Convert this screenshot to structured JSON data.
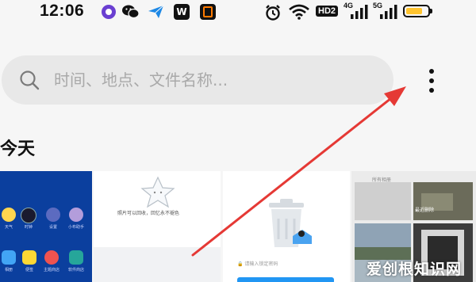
{
  "status_bar": {
    "time": "12:06",
    "hd_label": "HD2",
    "net_1": "4G",
    "net_2": "5G",
    "battery_level": 0.75,
    "icons": [
      "app-icon",
      "wechat-icon",
      "send-icon",
      "wps-icon",
      "app-icon",
      "alarm-icon",
      "wifi-icon",
      "signal-icon",
      "signal-icon",
      "battery-icon"
    ]
  },
  "search": {
    "placeholder": "时间、地点、文件名称..."
  },
  "menu": {
    "icon": "more-vertical-icon"
  },
  "section": {
    "title": "今天"
  },
  "thumbnails": {
    "t1": {
      "labels": [
        "天气",
        "时钟",
        "设置",
        "小布助手",
        "相册",
        "便签",
        "主题商店",
        "软件商店"
      ]
    },
    "t2": {
      "caption": "照片可以回收，回忆永不褪色"
    },
    "t3": {
      "input_hint": "请输入锁定密码"
    },
    "t4": {
      "label_1": "所有相册",
      "label_2": "最近删除"
    }
  },
  "watermark": "爱创根知识网",
  "colors": {
    "accent_arrow": "#e53935",
    "battery_fill": "#ffc42e",
    "home_bg": "#0b3f9e"
  }
}
